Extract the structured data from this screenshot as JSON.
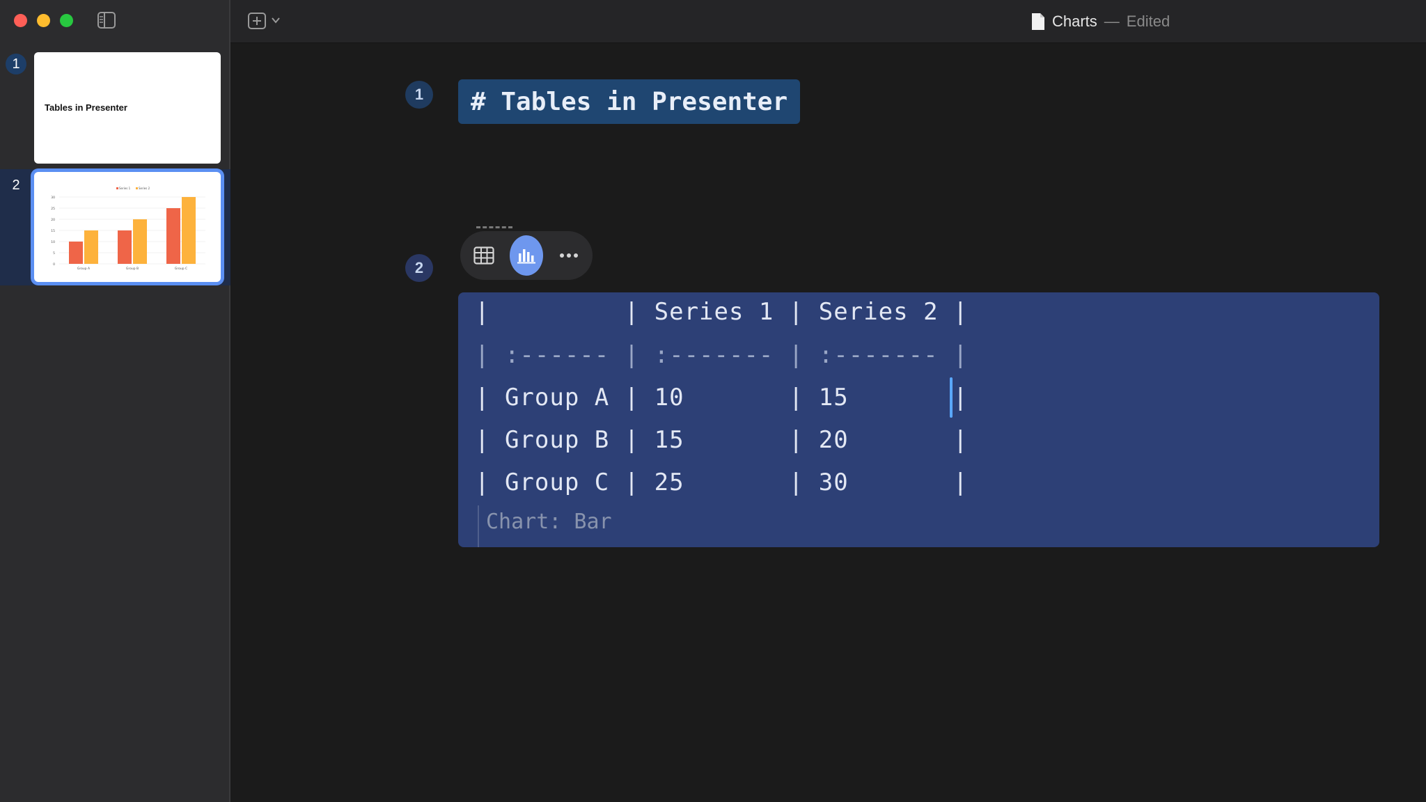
{
  "window": {
    "title": "Charts",
    "separator": "—",
    "status": "Edited"
  },
  "sidebar": {
    "slides": [
      {
        "number": "1",
        "title": "Tables in Presenter"
      },
      {
        "number": "2",
        "mini_chart": {
          "legend": [
            "Series 1",
            "Series 2"
          ],
          "categories": [
            "Group A",
            "Group B",
            "Group C"
          ],
          "series": [
            {
              "name": "Series 1",
              "values": [
                10,
                15,
                25
              ]
            },
            {
              "name": "Series 2",
              "values": [
                15,
                20,
                30
              ]
            }
          ],
          "ylim": [
            0,
            30
          ],
          "yticks": [
            "30",
            "25",
            "20",
            "15",
            "10",
            "5",
            "0"
          ]
        }
      }
    ]
  },
  "editor": {
    "slides": [
      {
        "badge": "1",
        "heading": "# Tables in Presenter"
      },
      {
        "badge": "2",
        "table_rows": [
          "|         | Series 1 | Series 2 |",
          "| :------ | :------- | :------- |",
          "| Group A | 10       | 15       |",
          "| Group B | 15       | 20       |",
          "| Group C | 25       | 30       |"
        ],
        "caption": "Chart: Bar"
      }
    ]
  },
  "toolbar": {
    "table_icon": "table-icon",
    "chart_icon": "bar-chart-icon",
    "more_icon": "more-icon"
  },
  "colors": {
    "series_1": "#ef6548",
    "series_2": "#fdb23c",
    "selection_accent": "#5b8ff2",
    "table_block_bg": "#2d4076",
    "heading_block_bg": "#1f4671"
  },
  "chart_data": {
    "type": "bar",
    "categories": [
      "Group A",
      "Group B",
      "Group C"
    ],
    "series": [
      {
        "name": "Series 1",
        "values": [
          10,
          15,
          25
        ]
      },
      {
        "name": "Series 2",
        "values": [
          15,
          20,
          30
        ]
      }
    ],
    "ylim": [
      0,
      30
    ],
    "legend": "top"
  }
}
